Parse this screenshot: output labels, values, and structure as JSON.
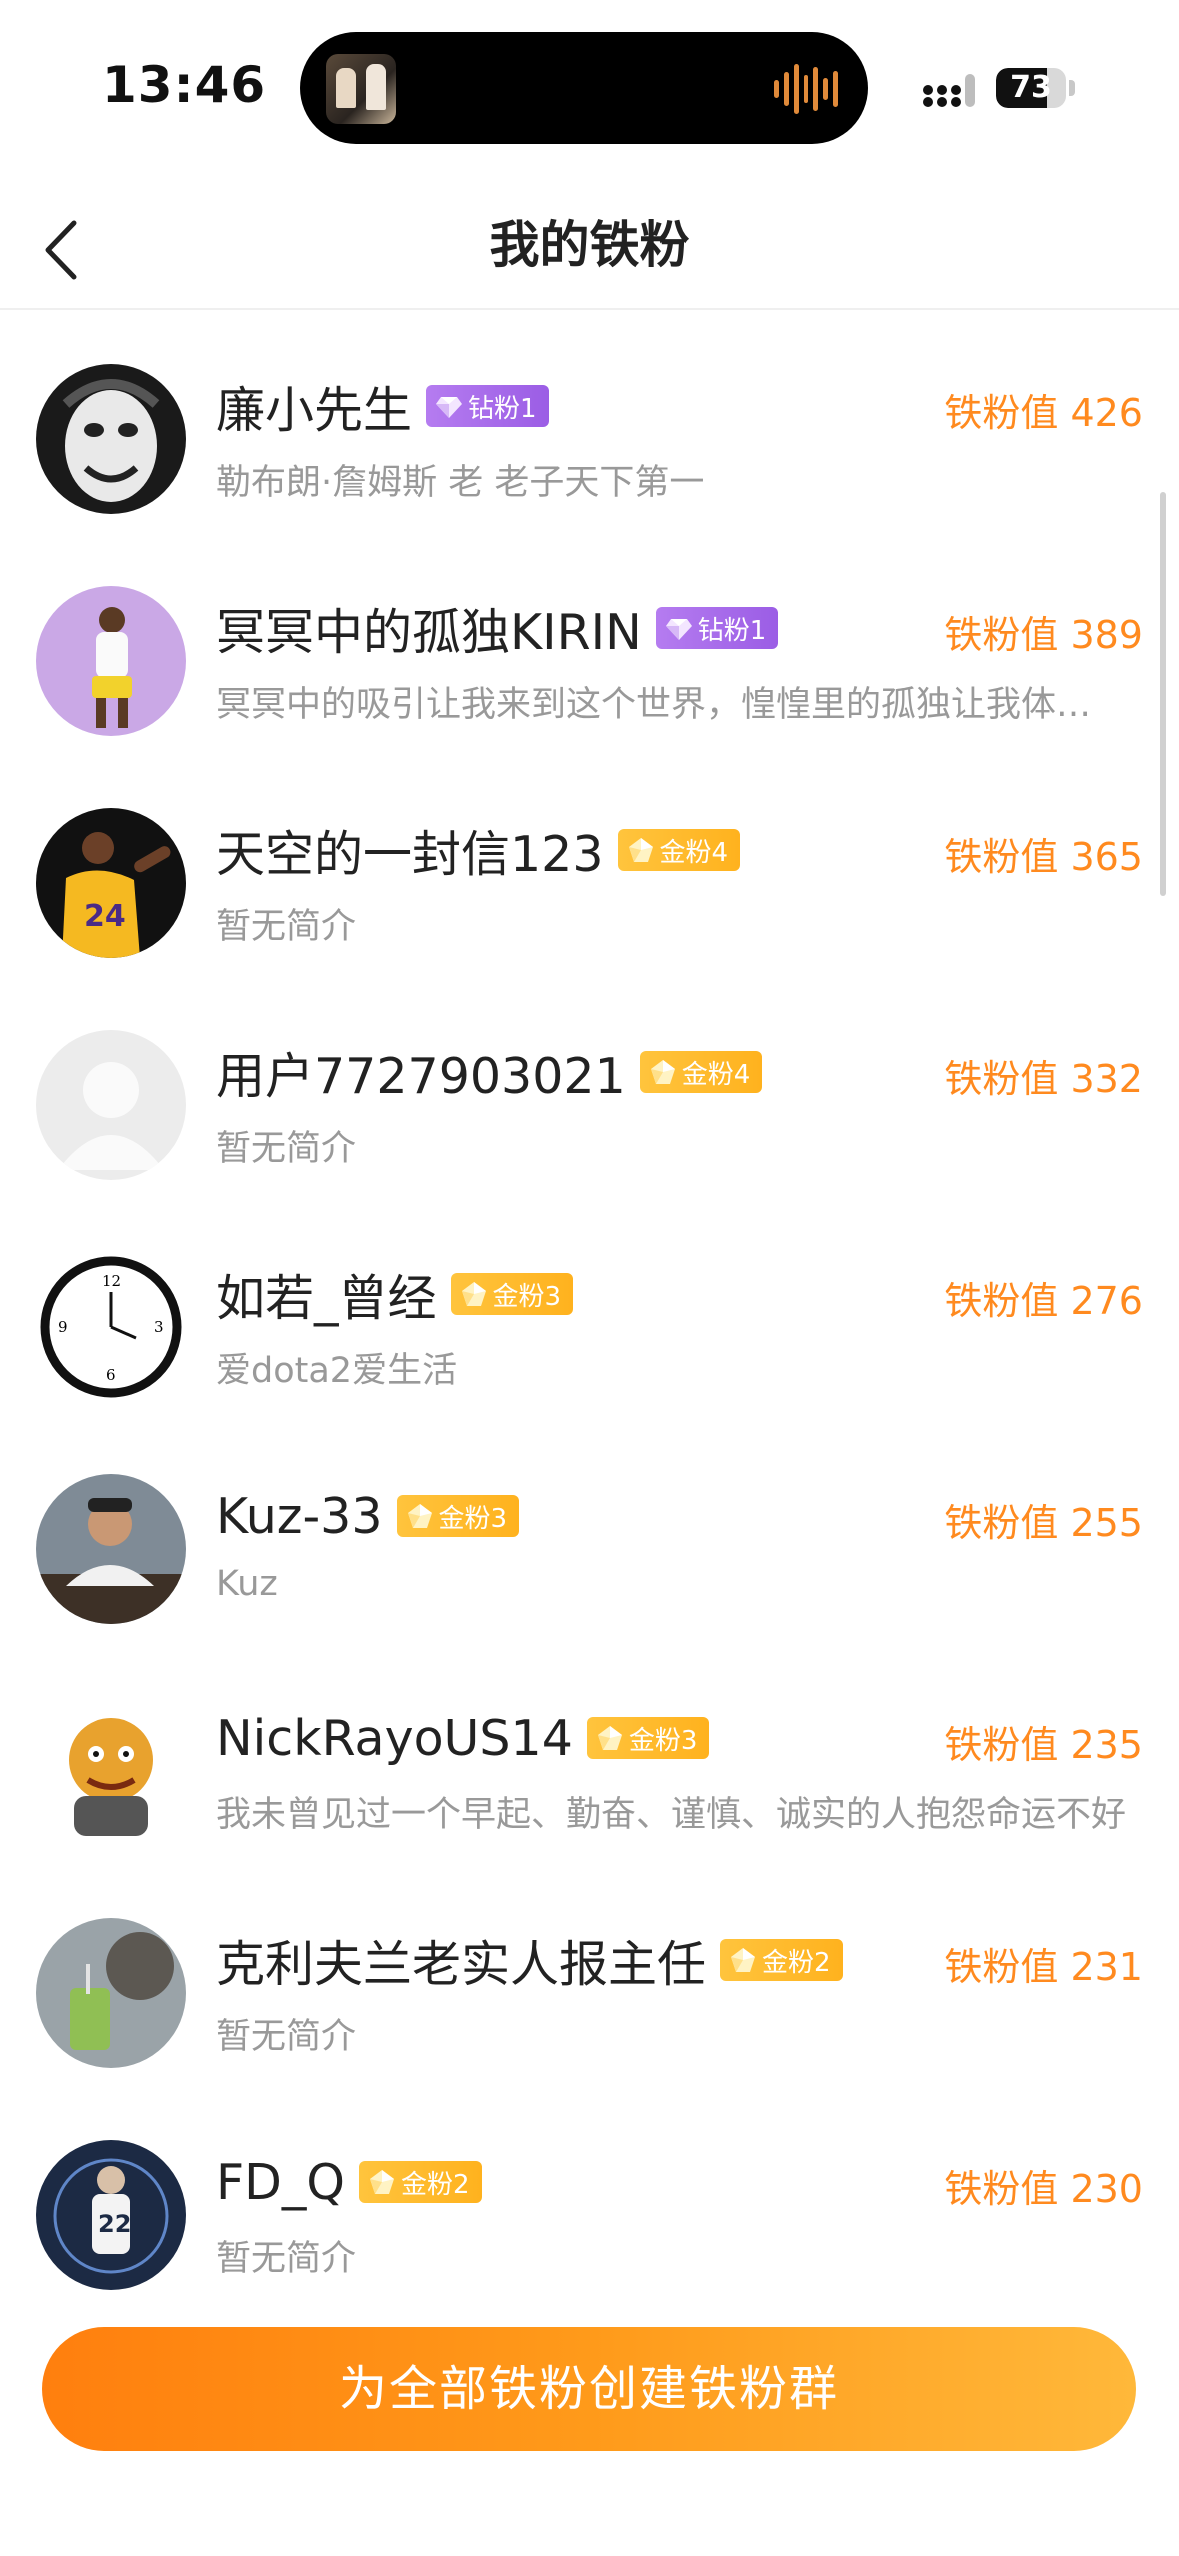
{
  "status_bar": {
    "time": "13:46",
    "battery": "73",
    "battery_level": 0.73
  },
  "nav": {
    "title": "我的铁粉"
  },
  "fans": [
    {
      "name": "廉小先生",
      "badge": "钻粉1",
      "badge_type": "diamond",
      "value": "铁粉值 426",
      "bio": "勒布朗·詹姆斯 老 老子天下第一",
      "avatar": "face-sketch"
    },
    {
      "name": "冥冥中的孤独KIRIN",
      "badge": "钻粉1",
      "badge_type": "diamond",
      "value": "铁粉值 389",
      "bio": "冥冥中的吸引让我来到这个世界，惶惶里的孤独让我体验这个世界",
      "avatar": "player-purple"
    },
    {
      "name": "天空的一封信123",
      "badge": "金粉4",
      "badge_type": "gold",
      "value": "铁粉值 365",
      "bio": "暂无简介",
      "avatar": "lakers-24"
    },
    {
      "name": "用户7727903021",
      "badge": "金粉4",
      "badge_type": "gold",
      "value": "铁粉值 332",
      "bio": "暂无简介",
      "avatar": "default-user"
    },
    {
      "name": "如若_曾经",
      "badge": "金粉3",
      "badge_type": "gold",
      "value": "铁粉值 276",
      "bio": "爱dota2爱生活",
      "avatar": "clock"
    },
    {
      "name": "Kuz-33",
      "badge": "金粉3",
      "badge_type": "gold",
      "value": "铁粉值 255",
      "bio": "Kuz",
      "avatar": "man-photo"
    },
    {
      "name": "NickRayoUS14",
      "badge": "金粉3",
      "badge_type": "gold",
      "value": "铁粉值 235",
      "bio": "我未曾见过一个早起、勤奋、谨慎、诚实的人抱怨命运不好",
      "avatar": "cartoon-beast"
    },
    {
      "name": "克利夫兰老实人报主任",
      "badge": "金粉2",
      "badge_type": "gold",
      "value": "铁粉值 231",
      "bio": "暂无简介",
      "avatar": "drink-photo"
    },
    {
      "name": "FD_Q",
      "badge": "金粉2",
      "badge_type": "gold",
      "value": "铁粉值 230",
      "bio": "暂无简介",
      "avatar": "player-22"
    }
  ],
  "cta": {
    "label": "为全部铁粉创建铁粉群"
  },
  "colors": {
    "accent": "#ff8a1f",
    "diamond_badge": "#a56be9",
    "gold_badge": "#ffba2a"
  }
}
